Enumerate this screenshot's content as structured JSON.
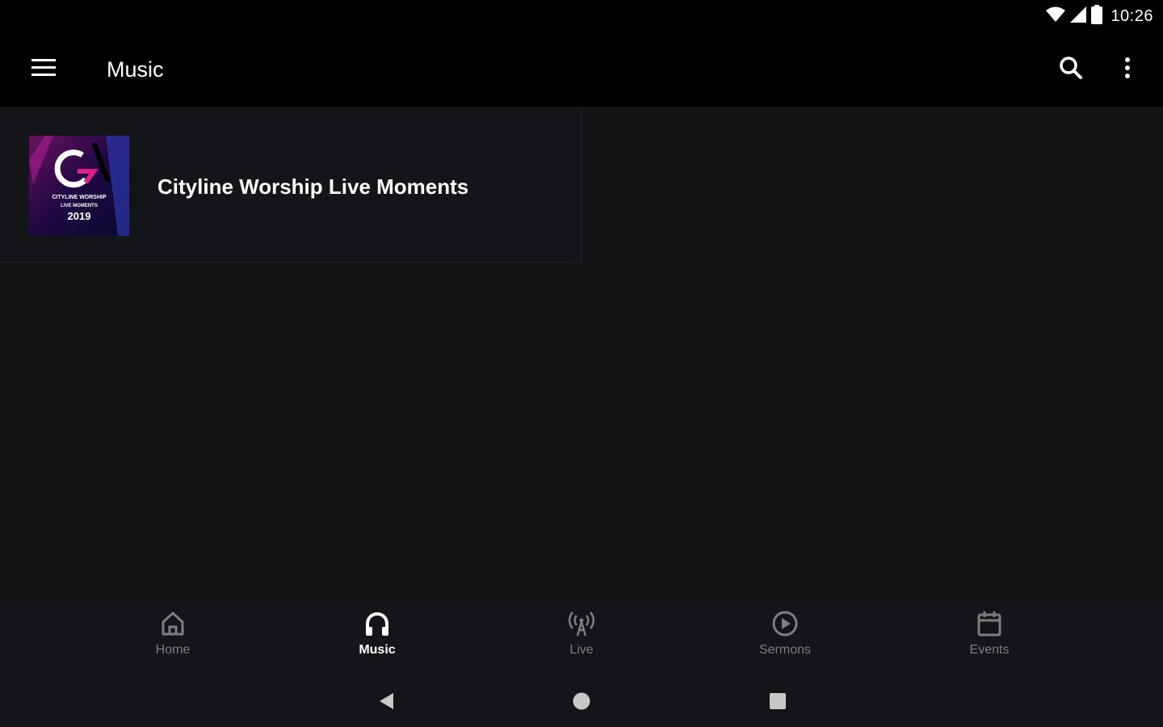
{
  "status_bar": {
    "time": "10:26",
    "icons": [
      "wifi-icon",
      "signal-icon",
      "battery-icon"
    ]
  },
  "app_bar": {
    "title": "Music",
    "menu_icon": "menu-icon",
    "search_icon": "search-icon",
    "more_icon": "more-vert-icon"
  },
  "albums": [
    {
      "title": "Cityline Worship Live Moments",
      "art": {
        "line1": "CITYLINE WORSHIP",
        "line2": "LIVE MOMENTS",
        "year": "2019"
      }
    }
  ],
  "bottom_nav": {
    "items": [
      {
        "label": "Home",
        "icon": "home-icon",
        "active": false
      },
      {
        "label": "Music",
        "icon": "headphones-icon",
        "active": true
      },
      {
        "label": "Live",
        "icon": "broadcast-icon",
        "active": false
      },
      {
        "label": "Sermons",
        "icon": "play-circle-icon",
        "active": false
      },
      {
        "label": "Events",
        "icon": "calendar-icon",
        "active": false
      }
    ]
  },
  "system_nav": {
    "icons": [
      "back-icon",
      "home-circle-icon",
      "recents-icon"
    ]
  },
  "colors": {
    "background": "#131416",
    "bar": "#000000",
    "inactive": "#7d7e80",
    "active": "#ffffff"
  }
}
